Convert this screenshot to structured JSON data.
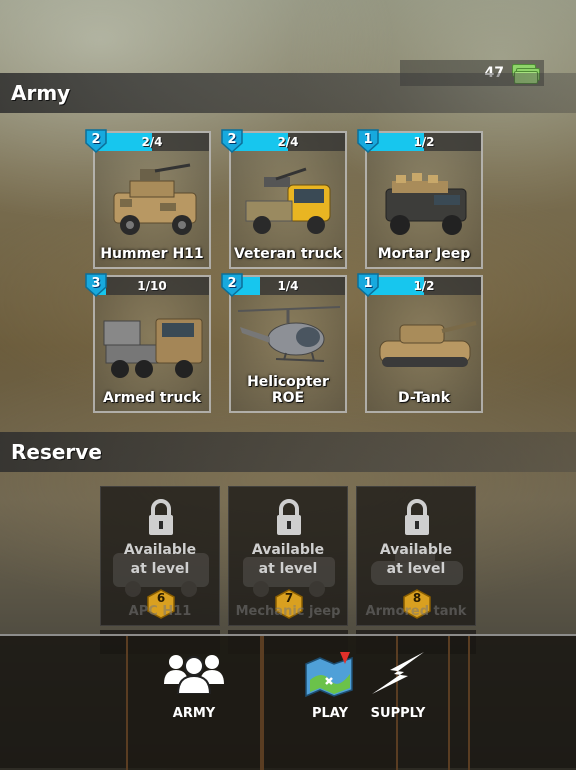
{
  "currency": {
    "amount": "47",
    "icon": "cash-icon"
  },
  "army": {
    "title": "Army",
    "cards": [
      {
        "name": "Hummer H11",
        "level": "2",
        "count": "2/4",
        "progress": 0.5,
        "icon": "humvee-icon"
      },
      {
        "name": "Veteran truck",
        "level": "2",
        "count": "2/4",
        "progress": 0.5,
        "icon": "pickup-truck-icon"
      },
      {
        "name": "Mortar Jeep",
        "level": "1",
        "count": "1/2",
        "progress": 0.5,
        "icon": "jeep-icon"
      },
      {
        "name": "Armed truck",
        "level": "3",
        "count": "1/10",
        "progress": 0.1,
        "icon": "armed-truck-icon"
      },
      {
        "name": "Helicopter ROE",
        "level": "2",
        "count": "1/4",
        "progress": 0.25,
        "icon": "helicopter-icon"
      },
      {
        "name": "D-Tank",
        "level": "1",
        "count": "1/2",
        "progress": 0.5,
        "icon": "tank-icon"
      }
    ]
  },
  "reserve": {
    "title": "Reserve",
    "cards": [
      {
        "text": "Available at level",
        "level": "6",
        "ghost_name": "APC H11"
      },
      {
        "text": "Available at level",
        "level": "7",
        "ghost_name": "Mechanic jeep"
      },
      {
        "text": "Available at level",
        "level": "8",
        "ghost_name": "Armored tank"
      }
    ]
  },
  "nav": {
    "army": "ARMY",
    "play": "PLAY",
    "supply": "SUPPLY"
  },
  "colors": {
    "progress": "#17c6ee",
    "level_badge": "#17a9de",
    "reserve_badge": "#d9a020"
  }
}
